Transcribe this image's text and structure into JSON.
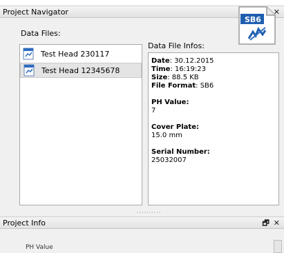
{
  "navigator": {
    "title": "Project Navigator",
    "data_files_label": "Data Files:",
    "files": [
      {
        "name": "Test Head 230117",
        "selected": false
      },
      {
        "name": "Test Head 12345678",
        "selected": true
      }
    ],
    "info_label": "Data File Infos:",
    "logo_text": "SB6",
    "info": {
      "date_key": "Date",
      "date_val": "30.12.2015",
      "time_key": "Time",
      "time_val": "16:19:23",
      "size_key": "Size",
      "size_val": "88.5 KB",
      "format_key": "File Format",
      "format_val": "SB6",
      "ph_key": "PH Value:",
      "ph_val": "7",
      "cover_key": "Cover Plate:",
      "cover_val": "15.0 mm",
      "serial_key": "Serial Number:",
      "serial_val": "25032007"
    }
  },
  "project_info": {
    "title": "Project Info",
    "ph_label": "PH Value"
  },
  "controls": {
    "float_glyph": "🗗",
    "close_glyph": "✕",
    "splitter_glyph": "··········"
  },
  "colors": {
    "logo_blue": "#1f5fb0",
    "selection": "#e4e4e4"
  }
}
